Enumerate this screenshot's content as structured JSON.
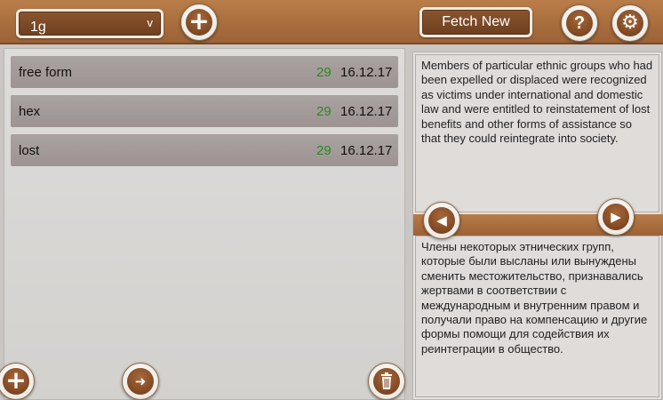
{
  "header": {
    "dropdown_value": "1g",
    "dropdown_chevron": "v",
    "fetch_label": "Fetch New",
    "icons": {
      "add": "plus-icon",
      "help": "question-icon",
      "settings": "gear-icon"
    }
  },
  "list": {
    "items": [
      {
        "name": "free form",
        "count": "29",
        "date": "16.12.17"
      },
      {
        "name": "hex",
        "count": "29",
        "date": "16.12.17"
      },
      {
        "name": "lost",
        "count": "29",
        "date": "16.12.17"
      }
    ]
  },
  "text_panel": {
    "source_text": "Members of particular ethnic groups who had been expelled or displaced were recognized as victims under international and domestic law and were entitled to reinstatement of lost benefits and other forms of assistance so that they could reintegrate into society.",
    "translation_text": "Члены некоторых этнических групп, которые были высланы или вынуждены сменить местожительство, признавались жертвами в соответствии с международным и внутренним правом и получали право на компенсацию и другие формы помощи для содействия их реинтеграции в общество."
  },
  "footer": {
    "icons": {
      "add": "plus-icon",
      "next": "arrow-right-icon",
      "delete": "trash-icon"
    }
  },
  "colors": {
    "wood": "#a36a3c",
    "count_green": "#2a8a1e",
    "row_bg": "#a39b99"
  }
}
